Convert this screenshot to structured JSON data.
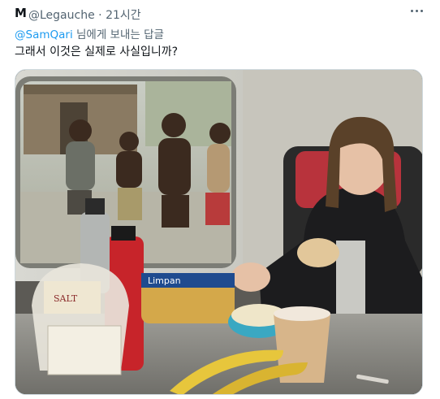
{
  "tweet": {
    "author_name": "M",
    "author_handle": "@Legauche",
    "separator": "·",
    "timestamp": "21시간",
    "reply_to_mention": "@SamQari",
    "reply_to_suffix": "님에게 보내는 답글",
    "text": "그래서 이것은 실제로 사실입니까?",
    "more_icon": "more-horizontal-icon"
  },
  "photo": {
    "visible_text": {
      "bread_bag": "Limpan",
      "cracker_box": "SALT"
    }
  },
  "colors": {
    "accent": "#1d9bf0",
    "muted": "#536471",
    "text": "#0f1419",
    "border": "#cfd9de"
  }
}
